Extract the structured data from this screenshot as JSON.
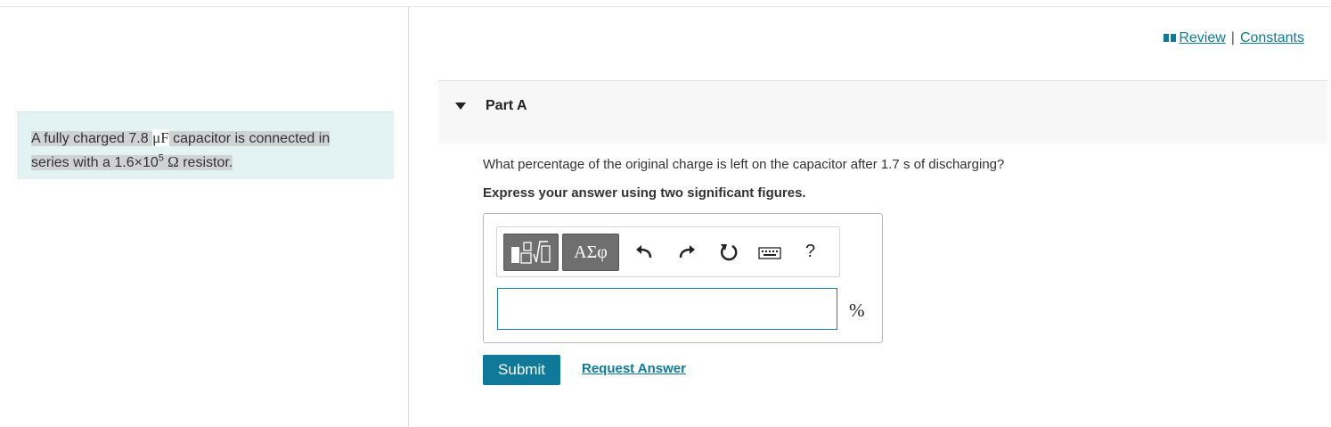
{
  "problem": {
    "text_1": "A fully charged 7.8 ",
    "capacitance_unit": "μF",
    "text_2": " capacitor is connected in",
    "text_3": "series with a 1.6×10",
    "exponent": "5",
    "resistance_unit": " Ω",
    "text_4": " resistor."
  },
  "header_links": {
    "review": "Review",
    "separator": "|",
    "constants": "Constants"
  },
  "part": {
    "title": "Part A",
    "question": "What percentage of the original charge is left on the capacitor after 1.7 s of discharging?",
    "instruction": "Express your answer using two significant figures."
  },
  "toolbar": {
    "greek_label": "ΑΣφ",
    "help_label": "?"
  },
  "answer": {
    "value": "",
    "unit": "%"
  },
  "actions": {
    "submit": "Submit",
    "request": "Request Answer"
  },
  "colors": {
    "accent": "#10799a",
    "problem_bg": "#e3f3f4",
    "link": "#107a96"
  }
}
